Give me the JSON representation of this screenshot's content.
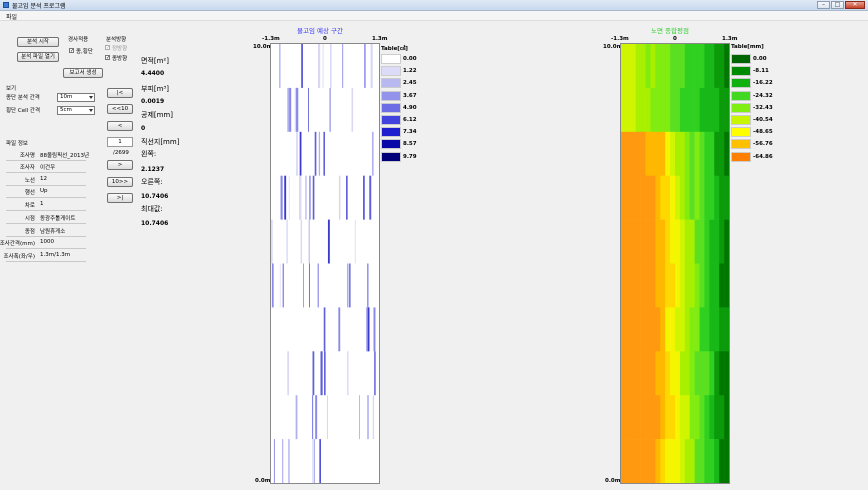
{
  "window": {
    "title": "물고임 분석 프로그램",
    "min": "–",
    "max": "□",
    "close": "✕"
  },
  "menu": {
    "file": "파일"
  },
  "controls": {
    "start_button": "분석 시작",
    "open_button": "분석 파일 열기",
    "slope_label": "경사적용",
    "crossslope_label": "종,횡단",
    "direction_label": "분석방향",
    "forward_label": "정방향",
    "reverse_label": "종방향",
    "report_button": "보고서 생성"
  },
  "view": {
    "heading": "보기",
    "long_interval_label": "종단 분석 간격",
    "long_interval_value": "10m",
    "cross_cell_label": "횡단 Cell 간격",
    "cross_cell_value": "5cm"
  },
  "nav": {
    "first": "|<",
    "prev10": "<<10",
    "prev": "<",
    "page": "1",
    "total": "/2699",
    "next": ">",
    "next10": "10>>",
    "last": ">|"
  },
  "fileinfo": {
    "heading": "파일 정보",
    "rows": [
      {
        "label": "조사명",
        "value": "88올림픽선_2013년"
      },
      {
        "label": "조사자",
        "value": "이건우"
      },
      {
        "label": "노선",
        "value": "12"
      },
      {
        "label": "행선",
        "value": "Up"
      },
      {
        "label": "차로",
        "value": "1"
      },
      {
        "label": "시점",
        "value": "동광주톨게이트"
      },
      {
        "label": "종점",
        "value": "남원휴게소"
      },
      {
        "label": "조사간격(mm)",
        "value": "1000"
      },
      {
        "label": "조사폭(좌/우)",
        "value": "1.3m/1.3m"
      }
    ]
  },
  "stats": [
    {
      "label": "면적[m²]",
      "value": "4.4400"
    },
    {
      "label": "부피[m³]",
      "value": "0.0019"
    },
    {
      "label": "공제[mm]",
      "value": "0"
    },
    {
      "label": "직선지[mm]",
      "value": ""
    },
    {
      "label": "왼쪽:",
      "value": "2.1237"
    },
    {
      "label": "오른쪽:",
      "value": "10.7406"
    },
    {
      "label": "최대값:",
      "value": "10.7406"
    }
  ],
  "chart_data": [
    {
      "type": "heatmap",
      "title": "물고임 예상 구간",
      "x_ticks": [
        "-1.3m",
        "0",
        "1.3m"
      ],
      "y_ticks": [
        "10.0m",
        "0.0m"
      ],
      "legend_title": "Table[㎠]",
      "legend": [
        {
          "label": "0.00",
          "color": "#ffffff"
        },
        {
          "label": "1.22",
          "color": "#dcdcf8"
        },
        {
          "label": "2.45",
          "color": "#b9b9f2"
        },
        {
          "label": "3.67",
          "color": "#9393ec"
        },
        {
          "label": "4.90",
          "color": "#6d6de6"
        },
        {
          "label": "6.12",
          "color": "#4343dd"
        },
        {
          "label": "7.34",
          "color": "#1f1fd0"
        },
        {
          "label": "8.57",
          "color": "#0808a8"
        },
        {
          "label": "9.79",
          "color": "#000078"
        }
      ]
    },
    {
      "type": "heatmap",
      "title": "노면 종합평점",
      "x_ticks": [
        "-1.3m",
        "0",
        "1.3m"
      ],
      "y_ticks": [
        "10.0m",
        "0.0m"
      ],
      "legend_title": "Table[mm]",
      "legend": [
        {
          "label": "0.00",
          "color": "#006400"
        },
        {
          "label": "-8.11",
          "color": "#008a00"
        },
        {
          "label": "-16.22",
          "color": "#10b010"
        },
        {
          "label": "-24.32",
          "color": "#40d820"
        },
        {
          "label": "-32.43",
          "color": "#80ee10"
        },
        {
          "label": "-40.54",
          "color": "#c8f500"
        },
        {
          "label": "-48.65",
          "color": "#ffff00"
        },
        {
          "label": "-56.76",
          "color": "#ffc000"
        },
        {
          "label": "-64.86",
          "color": "#ff8000"
        }
      ]
    }
  ]
}
